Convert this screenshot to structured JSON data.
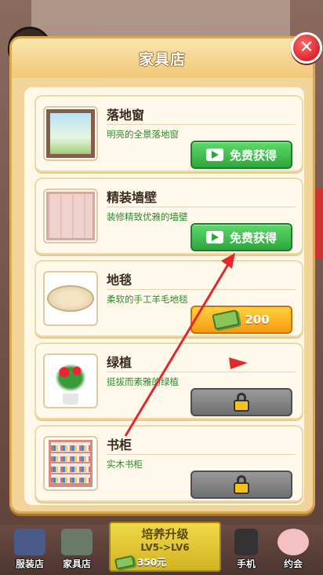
{
  "dialog": {
    "title": "家具店",
    "close_symbol": "✕"
  },
  "items": [
    {
      "name": "落地窗",
      "desc": "明亮的全景落地窗",
      "action": "免费获得",
      "action_type": "video",
      "thumb": "floor-window"
    },
    {
      "name": "精装墙壁",
      "desc": "装修精致优雅的墙壁",
      "action": "免费获得",
      "action_type": "video",
      "thumb": "wall"
    },
    {
      "name": "地毯",
      "desc": "柔软的手工羊毛地毯",
      "action": "200",
      "action_type": "buy",
      "thumb": "rug"
    },
    {
      "name": "绿植",
      "desc": "挺拔而素雅的绿植",
      "action": "",
      "action_type": "locked",
      "thumb": "plant"
    },
    {
      "name": "书柜",
      "desc": "实木书柜",
      "action": "",
      "action_type": "locked",
      "thumb": "bookshelf"
    }
  ],
  "bottom_nav": {
    "clothing_store": "服装店",
    "furniture_store": "家具店",
    "upgrade_title": "培养升级",
    "upgrade_level": "LV5->LV6",
    "upgrade_cost": "350元",
    "phone": "手机",
    "date": "约会"
  },
  "colors": {
    "accent_green": "#2ea63d",
    "accent_orange": "#f59a12",
    "locked_gray": "#6f6f6f",
    "desc_green": "#2e8a2e",
    "arrow_red": "#e2282a"
  }
}
